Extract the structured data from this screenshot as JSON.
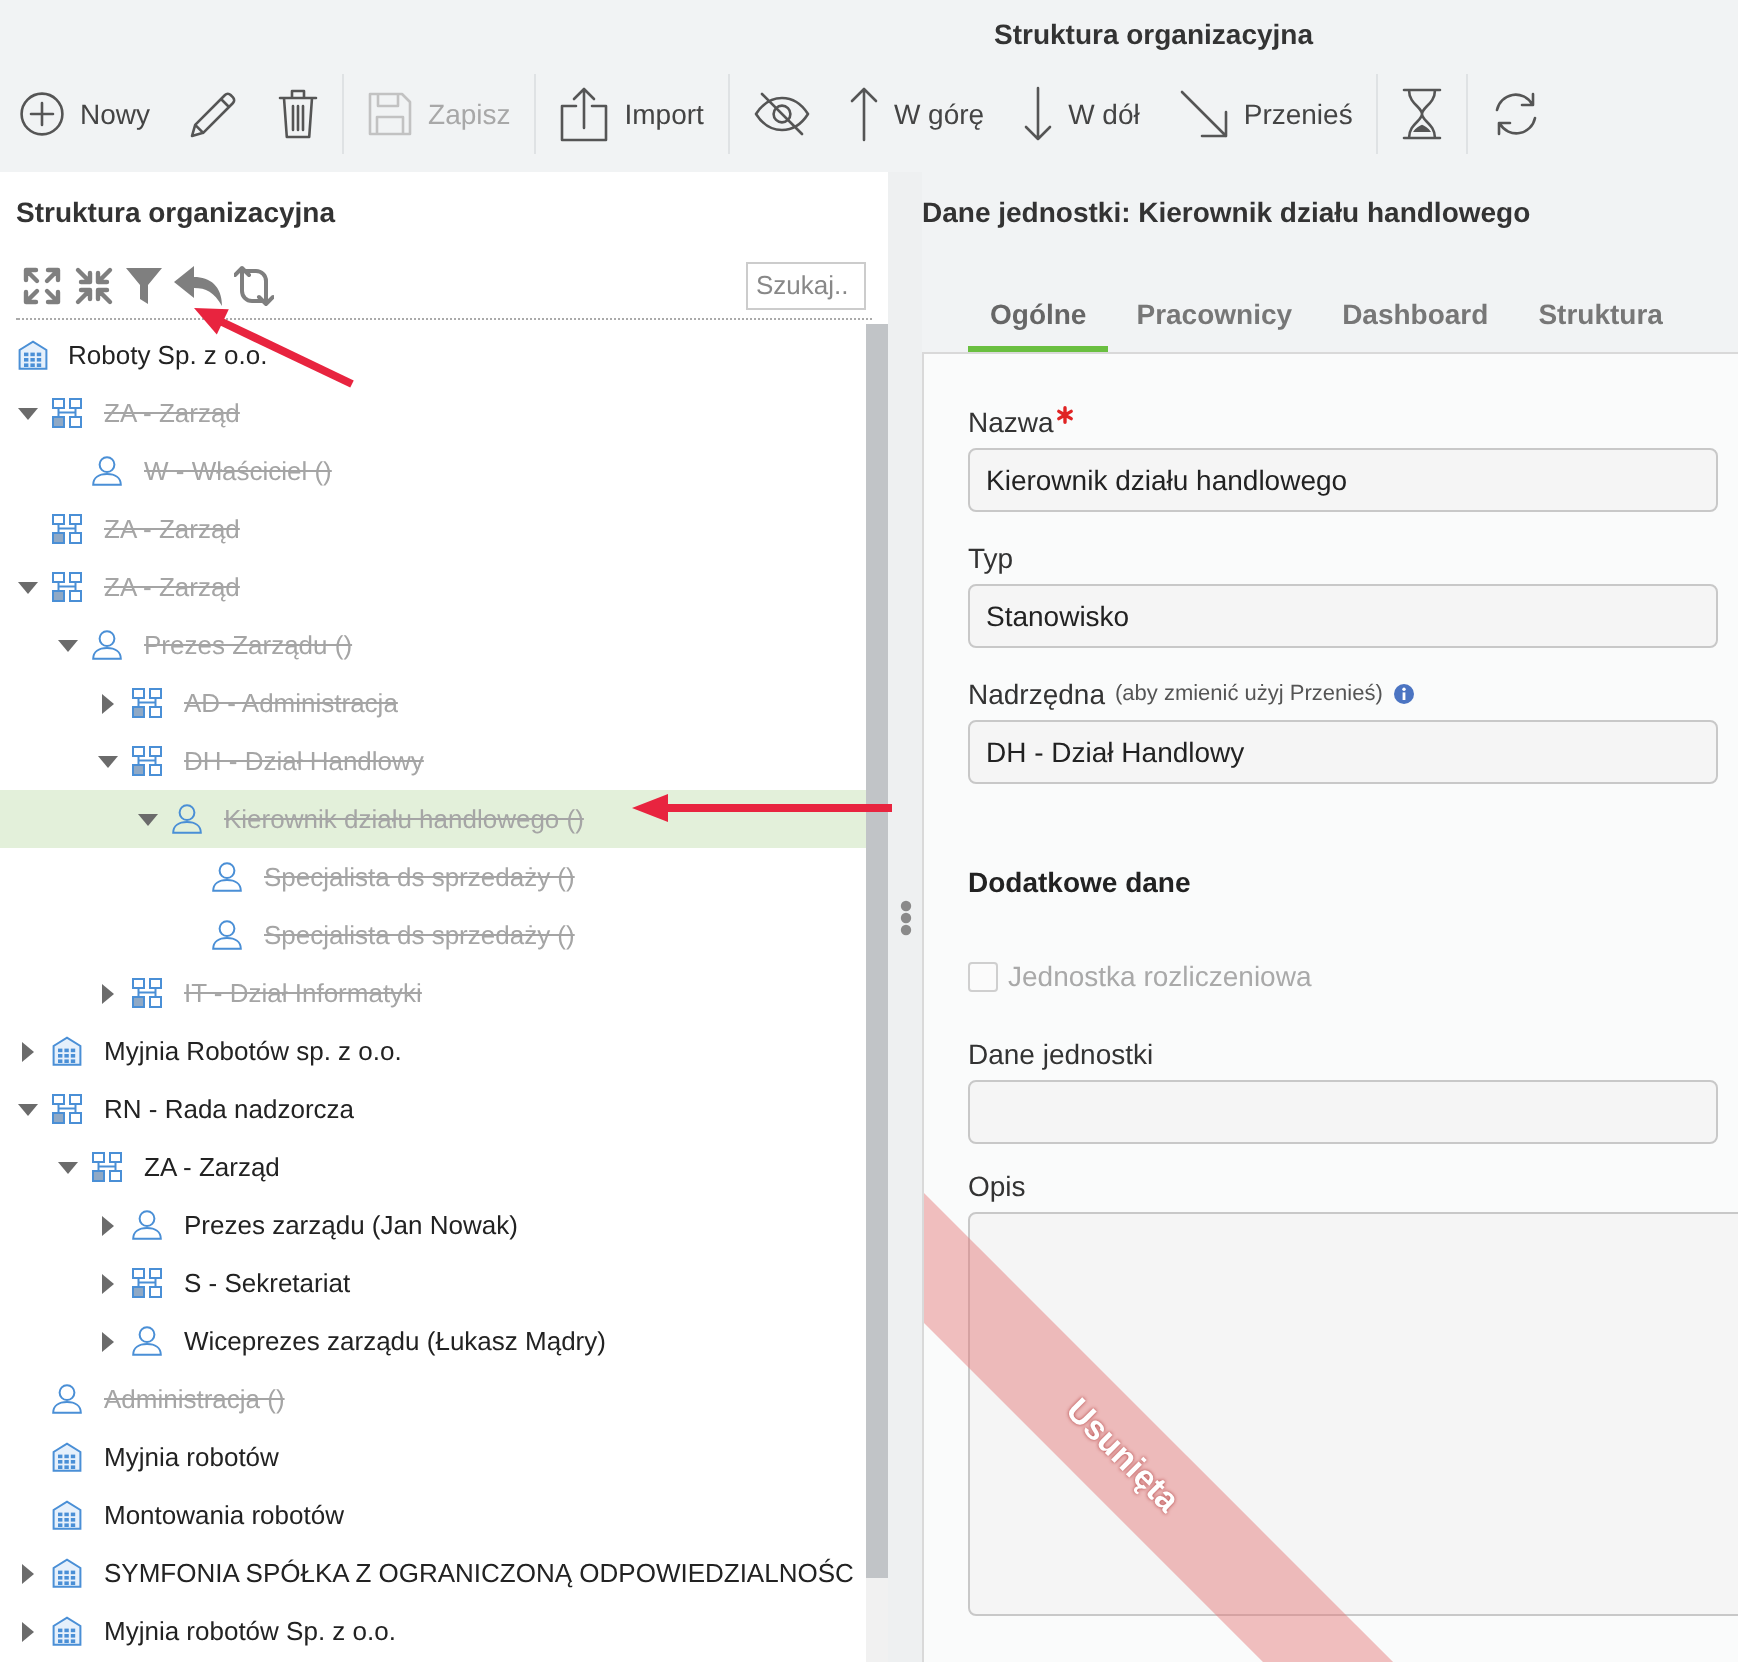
{
  "window": {
    "title": "Struktura organizacyjna"
  },
  "toolbar": {
    "groups": [
      [
        {
          "label": "Nowy",
          "disabled": false
        },
        {
          "disabled": false
        },
        {
          "disabled": false
        }
      ],
      [
        {
          "label": "Zapisz",
          "disabled": true
        }
      ],
      [
        {
          "label": "Import",
          "disabled": false
        }
      ],
      [
        {
          "disabled": false
        },
        {
          "label": "W górę",
          "disabled": false
        },
        {
          "label": "W dół",
          "disabled": false
        },
        {
          "label": "Przenieś",
          "disabled": false
        }
      ],
      [
        {
          "disabled": false
        }
      ],
      [
        {
          "disabled": false
        }
      ]
    ]
  },
  "tree_panel": {
    "title": "Struktura organizacyjna",
    "tools": [
      {
        "disabled": false
      },
      {
        "disabled": false
      },
      {
        "disabled": false
      },
      {
        "disabled": false
      },
      {
        "disabled": false
      }
    ],
    "search": {
      "placeholder": "Szukaj.."
    },
    "root": {
      "label": "Roboty Sp. z o.o.",
      "kind": "company",
      "deleted": false,
      "selected": false
    },
    "nodes": [
      {
        "label": "ZA - Zarząd",
        "kind": "unit",
        "deleted": true,
        "selected": false,
        "expanded": true,
        "children": [
          {
            "label": "W - Właściciel ()",
            "kind": "person",
            "deleted": true,
            "selected": false
          }
        ]
      },
      {
        "label": "ZA - Zarząd",
        "kind": "unit",
        "deleted": true,
        "selected": false
      },
      {
        "label": "ZA - Zarząd",
        "kind": "unit",
        "deleted": true,
        "selected": false,
        "expanded": true,
        "children": [
          {
            "label": "Prezes Zarządu ()",
            "kind": "person",
            "deleted": true,
            "selected": false,
            "expanded": true,
            "children": [
              {
                "label": "AD - Administracja",
                "kind": "unit",
                "deleted": true,
                "selected": false,
                "expanded": false
              },
              {
                "label": "DH - Dział Handlowy",
                "kind": "unit",
                "deleted": true,
                "selected": false,
                "expanded": true,
                "children": [
                  {
                    "label": "Kierownik działu handlowego ()",
                    "kind": "person",
                    "deleted": true,
                    "selected": true,
                    "expanded": true,
                    "children": [
                      {
                        "label": "Specjalista ds sprzedaży ()",
                        "kind": "person",
                        "deleted": true,
                        "selected": false
                      },
                      {
                        "label": "Specjalista ds sprzedaży ()",
                        "kind": "person",
                        "deleted": true,
                        "selected": false
                      }
                    ]
                  }
                ]
              },
              {
                "label": "IT - Dział Informatyki",
                "kind": "unit",
                "deleted": true,
                "selected": false,
                "expanded": false
              }
            ]
          }
        ]
      },
      {
        "label": "Myjnia Robotów sp. z o.o.",
        "kind": "company",
        "deleted": false,
        "selected": false,
        "expanded": false
      },
      {
        "label": "RN - Rada nadzorcza",
        "kind": "unit",
        "deleted": false,
        "selected": false,
        "expanded": true,
        "children": [
          {
            "label": "ZA - Zarząd",
            "kind": "unit",
            "deleted": false,
            "selected": false,
            "expanded": true,
            "children": [
              {
                "label": "Prezes zarządu (Jan Nowak)",
                "kind": "person",
                "deleted": false,
                "selected": false,
                "expanded": false
              },
              {
                "label": "S - Sekretariat",
                "kind": "unit",
                "deleted": false,
                "selected": false,
                "expanded": false
              },
              {
                "label": "Wiceprezes zarządu (Łukasz Mądry)",
                "kind": "person",
                "deleted": false,
                "selected": false,
                "expanded": false
              }
            ]
          }
        ]
      },
      {
        "label": "Administracja ()",
        "kind": "person",
        "deleted": true,
        "selected": false
      },
      {
        "label": "Myjnia robotów",
        "kind": "company",
        "deleted": false,
        "selected": false
      },
      {
        "label": "Montowania robotów",
        "kind": "company",
        "deleted": false,
        "selected": false
      },
      {
        "label": "SYMFONIA SPÓŁKA Z OGRANICZONĄ ODPOWIEDZIALNOŚC",
        "kind": "company",
        "deleted": false,
        "selected": false,
        "expanded": false
      },
      {
        "label": "Myjnia robotów Sp. z o.o.",
        "kind": "company",
        "deleted": false,
        "selected": false,
        "expanded": false
      }
    ]
  },
  "details_panel": {
    "title": "Dane jednostki: Kierownik działu handlowego",
    "tabs": [
      {
        "label": "Ogólne",
        "selected": true
      },
      {
        "label": "Pracownicy",
        "selected": false
      },
      {
        "label": "Dashboard",
        "selected": false
      },
      {
        "label": "Struktura",
        "selected": false
      }
    ],
    "form": [
      {
        "kind": "field",
        "label": "Nazwa",
        "required": true,
        "value": "Kierownik działu handlowego"
      },
      {
        "kind": "field",
        "label": "Typ",
        "required": false,
        "value": "Stanowisko"
      },
      {
        "kind": "field",
        "label": "Nadrzędna",
        "hint": "(aby zmienić użyj Przenieś)",
        "required": false,
        "value": "DH - Dział Handlowy"
      },
      {
        "kind": "heading",
        "label": "Dodatkowe dane"
      },
      {
        "kind": "checkbox",
        "label": "Jednostka rozliczeniowa",
        "checked": false,
        "disabled": true
      },
      {
        "kind": "field",
        "label": "Dane jednostki",
        "required": false
      },
      {
        "kind": "textarea",
        "label": "Opis",
        "required": false
      }
    ],
    "status_ribbon": "Usunięta"
  },
  "annotations": [
    {
      "kind": "arrow"
    },
    {
      "kind": "arrow"
    }
  ]
}
